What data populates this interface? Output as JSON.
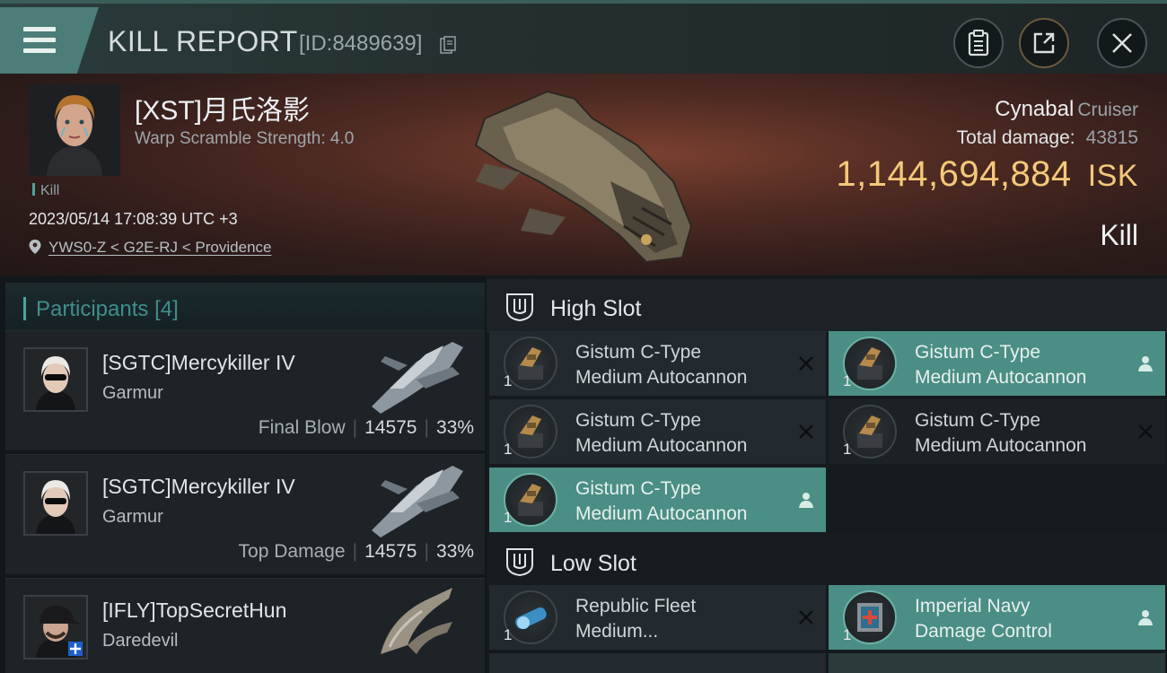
{
  "header": {
    "title": "KILL REPORT",
    "id_label": "[ID:8489639]"
  },
  "victim": {
    "name": "[XST]月氏洛影",
    "subtitle": "Warp Scramble Strength: 4.0",
    "tag": "Kill",
    "datetime": "2023/05/14 17:08:39 UTC +3",
    "location": "YWS0-Z < G2E-RJ < Providence"
  },
  "ship": {
    "name": "Cynabal",
    "class": "Cruiser",
    "total_damage_label": "Total damage:",
    "total_damage": "43815",
    "isk_value": "1,144,694,884",
    "isk_unit": "ISK",
    "result": "Kill"
  },
  "participants": {
    "label": "Participants",
    "count": "[4]",
    "rows": [
      {
        "name": "[SGTC]Mercykiller IV",
        "ship": "Garmur",
        "tag": "Final Blow",
        "damage": "14575",
        "percent": "33%"
      },
      {
        "name": "[SGTC]Mercykiller IV",
        "ship": "Garmur",
        "tag": "Top Damage",
        "damage": "14575",
        "percent": "33%"
      },
      {
        "name": "[IFLY]TopSecretHun",
        "ship": "Daredevil"
      }
    ]
  },
  "fittings": {
    "high_slot_label": "High Slot",
    "low_slot_label": "Low Slot",
    "high": [
      {
        "line1": "Gistum C-Type",
        "line2": "Medium Autocannon",
        "qty": "1",
        "state": "destroyed"
      },
      {
        "line1": "Gistum C-Type",
        "line2": "Medium Autocannon",
        "qty": "1",
        "state": "dropped"
      },
      {
        "line1": "Gistum C-Type",
        "line2": "Medium Autocannon",
        "qty": "1",
        "state": "destroyed"
      },
      {
        "line1": "Gistum C-Type",
        "line2": "Medium Autocannon",
        "qty": "1",
        "state": "destroyed"
      },
      {
        "line1": "Gistum C-Type",
        "line2": "Medium Autocannon",
        "qty": "1",
        "state": "dropped"
      }
    ],
    "low": [
      {
        "line1": "Republic Fleet",
        "line2": "Medium...",
        "qty": "1",
        "state": "destroyed"
      },
      {
        "line1": "Imperial Navy",
        "line2": "Damage Control",
        "qty": "1",
        "state": "dropped"
      }
    ]
  },
  "colors": {
    "accent_teal": "#4a8e85",
    "isk_gold": "#f3c97a",
    "header_teal": "#4c7d78"
  },
  "icons": [
    "menu-icon",
    "copy-icon",
    "clipboard-icon",
    "share-icon",
    "close-icon",
    "pin-icon",
    "shield-slot-icon",
    "destroyed-x-icon",
    "dropped-person-icon",
    "add-plus-icon"
  ]
}
